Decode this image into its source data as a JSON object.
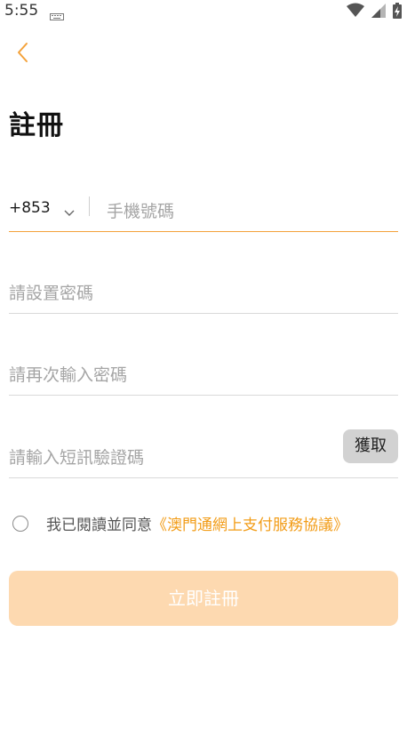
{
  "status_bar": {
    "time": "5:55",
    "icons": [
      "keyboard-icon",
      "wifi-icon",
      "signal-icon",
      "battery-charging-icon"
    ]
  },
  "header": {
    "back_icon": "chevron-left-icon",
    "title": "註冊"
  },
  "form": {
    "country_code": "+853",
    "phone_placeholder": "手機號碼",
    "password_placeholder": "請設置密碼",
    "confirm_password_placeholder": "請再次輸入密碼",
    "sms_code_placeholder": "請輸入短訊驗證碼",
    "get_code_label": "獲取"
  },
  "agreement": {
    "prefix": "我已閱讀並同意",
    "link_text": "《澳門通網上支付服務協議》"
  },
  "submit": {
    "label": "立即註冊"
  },
  "colors": {
    "accent": "#f4a23a",
    "link": "#f29c17",
    "submit_disabled_bg": "#fdd9b0",
    "get_button_bg": "#d2d2d2"
  }
}
